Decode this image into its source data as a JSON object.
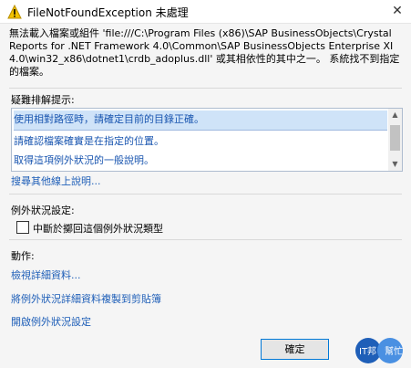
{
  "title": {
    "text": "FileNotFoundException 未處理",
    "close_glyph": "✕"
  },
  "message": {
    "text": "無法載入檔案或組件 'file:///C:\\Program Files (x86)\\SAP BusinessObjects\\Crystal Reports for .NET Framework 4.0\\Common\\SAP BusinessObjects Enterprise XI 4.0\\win32_x86\\dotnet1\\crdb_adoplus.dll' 或其相依性的其中之一。 系統找不到指定的檔案。"
  },
  "troubleshooting": {
    "label": "疑難排解提示:",
    "tips": [
      "使用相對路徑時，請確定目前的目錄正確。",
      "請確認檔案確實是在指定的位置。",
      "取得這項例外狀況的一般說明。"
    ],
    "search_link": "搜尋其他線上說明..."
  },
  "exception_settings": {
    "label": "例外狀況設定:",
    "checkbox_label": "中斷於擲回這個例外狀況類型",
    "checked": false
  },
  "actions": {
    "label": "動作:",
    "links": [
      "檢視詳細資料...",
      "將例外狀況詳細資料複製到剪貼簿",
      "開啟例外狀況設定"
    ]
  },
  "buttons": {
    "ok": "確定"
  },
  "watermark": {
    "text1": "IT邦",
    "text2": "幫忙"
  }
}
